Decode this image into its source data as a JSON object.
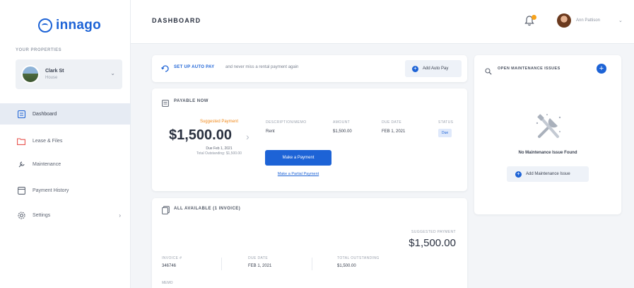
{
  "app": {
    "logo_text": "innago",
    "brand_color": "#1d63d6",
    "accent_orange": "#f6a21c"
  },
  "sidebar": {
    "properties_title": "YOUR PROPERTIES",
    "property": {
      "name": "Clark St",
      "sub": "House"
    },
    "items": [
      {
        "label": "Dashboard",
        "icon": "dashboard-icon",
        "active": true
      },
      {
        "label": "Lease & Files",
        "icon": "folder-icon",
        "active": false
      },
      {
        "label": "Maintenance",
        "icon": "wrench-icon",
        "active": false
      },
      {
        "label": "Payment History",
        "icon": "payment-history-icon",
        "active": false
      },
      {
        "label": "Settings",
        "icon": "gear-icon",
        "active": false
      }
    ]
  },
  "header": {
    "title": "DASHBOARD",
    "user_name": "Ann Pattison"
  },
  "autopay": {
    "title": "SET UP AUTO PAY",
    "text": "and never miss a rental payment again",
    "button": "Add Auto Pay"
  },
  "payable": {
    "title": "PAYABLE NOW",
    "suggested_label": "Suggested Payment",
    "amount": "$1,500.00",
    "due": "Due Feb 1, 2021",
    "outstanding": "Total Outstanding: $1,500.00",
    "columns": [
      {
        "head": "DESCRIPTION/MEMO",
        "value": "Rent"
      },
      {
        "head": "AMOUNT",
        "value": "$1,500.00"
      },
      {
        "head": "DUE DATE",
        "value": "FEB 1, 2021"
      },
      {
        "head": "STATUS",
        "value": "Due"
      }
    ],
    "pay_button": "Make a Payment",
    "partial_link": "Make a Partial Payment"
  },
  "invoices": {
    "title": "ALL AVAILABLE (1 INVOICE)",
    "suggested_label": "SUGGESTED PAYMENT",
    "suggested_amount": "$1,500.00",
    "columns": [
      {
        "head": "INVOICE #",
        "value": "346746"
      },
      {
        "head": "DUE DATE",
        "value": "FEB 1, 2021"
      },
      {
        "head": "TOTAL OUTSTANDING",
        "value": "$1,500.00"
      }
    ],
    "more_label": "MEMO"
  },
  "maintenance": {
    "title": "OPEN MAINTENANCE ISSUES",
    "empty_text": "No Maintenance Issue Found",
    "button": "Add Maintenance Issue"
  }
}
